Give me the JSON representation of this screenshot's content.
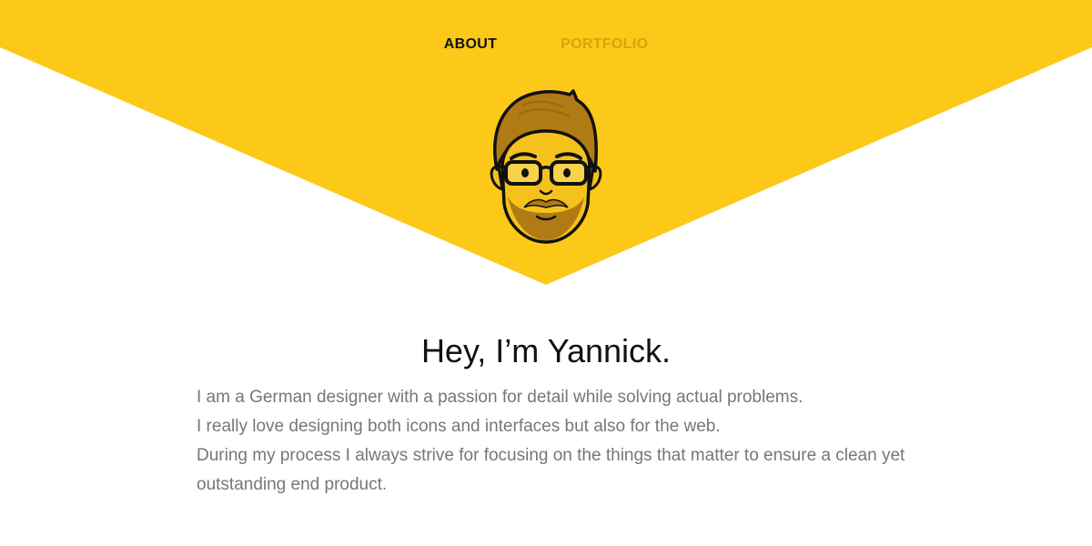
{
  "theme": {
    "accent": "#fdc918",
    "nav_active": "#111111",
    "nav_inactive": "#d6a50a",
    "text_primary": "#111111",
    "text_secondary": "#777777"
  },
  "nav": {
    "items": [
      {
        "label": "ABOUT",
        "active": true
      },
      {
        "label": "PORTFOLIO",
        "active": false
      }
    ]
  },
  "hero": {
    "avatar_icon": "bearded-man-with-glasses-avatar"
  },
  "main": {
    "title": "Hey, I’m Yannick.",
    "bio_lines": [
      "I am a German designer with a passion for detail while solving actual problems.",
      "I really love designing both icons and interfaces but also for the web.",
      "During my process I always strive for focusing on the things that matter to ensure a clean yet outstanding end product."
    ]
  }
}
